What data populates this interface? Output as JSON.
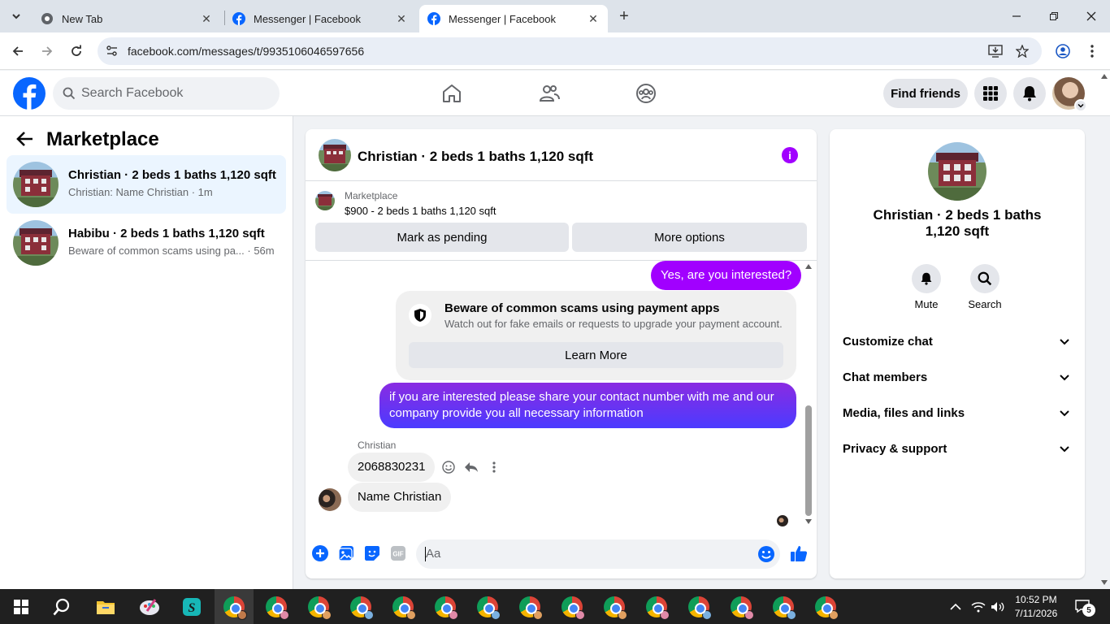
{
  "browser": {
    "tabs": [
      {
        "label": "New Tab",
        "active": false
      },
      {
        "label": "Messenger | Facebook",
        "active": false
      },
      {
        "label": "Messenger | Facebook",
        "active": true
      }
    ],
    "url": "facebook.com/messages/t/9935106046597656"
  },
  "fb_header": {
    "search_placeholder": "Search Facebook",
    "find_friends": "Find friends"
  },
  "left_panel": {
    "title": "Marketplace",
    "conversations": [
      {
        "name": "Christian · 2 beds 1 baths 1,120 sqft",
        "preview": "Christian: Name Christian · 1m",
        "selected": true
      },
      {
        "name": "Habibu · 2 beds 1 baths 1,120 sqft",
        "preview": "Beware of common scams using pa...  · 56m",
        "selected": false
      }
    ]
  },
  "chat": {
    "title": "Christian · 2 beds 1 baths 1,120 sqft",
    "marketplace_label": "Marketplace",
    "listing": "$900 - 2 beds 1 baths 1,120 sqft",
    "mark_pending": "Mark as pending",
    "more_options": "More options",
    "messages": {
      "out1": "Yes, are you interested?",
      "scam_title": "Beware of common scams using payment apps",
      "scam_desc": "Watch out for fake emails or requests to upgrade your payment account.",
      "learn_more": "Learn More",
      "out2": "if you are interested please share your contact number with me and our company provide you all necessary information",
      "sender": "Christian",
      "in1": "2068830231",
      "in2": "Name Christian"
    },
    "composer_placeholder": "Aa"
  },
  "right_panel": {
    "title": "Christian · 2 beds 1 baths 1,120 sqft",
    "actions": [
      {
        "label": "Mute",
        "icon": "bell-icon"
      },
      {
        "label": "Search",
        "icon": "search-icon"
      }
    ],
    "sections": [
      "Customize chat",
      "Chat members",
      "Media, files and links",
      "Privacy & support"
    ]
  },
  "taskbar": {
    "time": "10:52 PM",
    "date": "7/11/2026",
    "notification_count": "5"
  },
  "colors": {
    "facebook_blue": "#0866ff",
    "messenger_purple": "#a100ff",
    "selected_bg": "#ebf5ff"
  }
}
